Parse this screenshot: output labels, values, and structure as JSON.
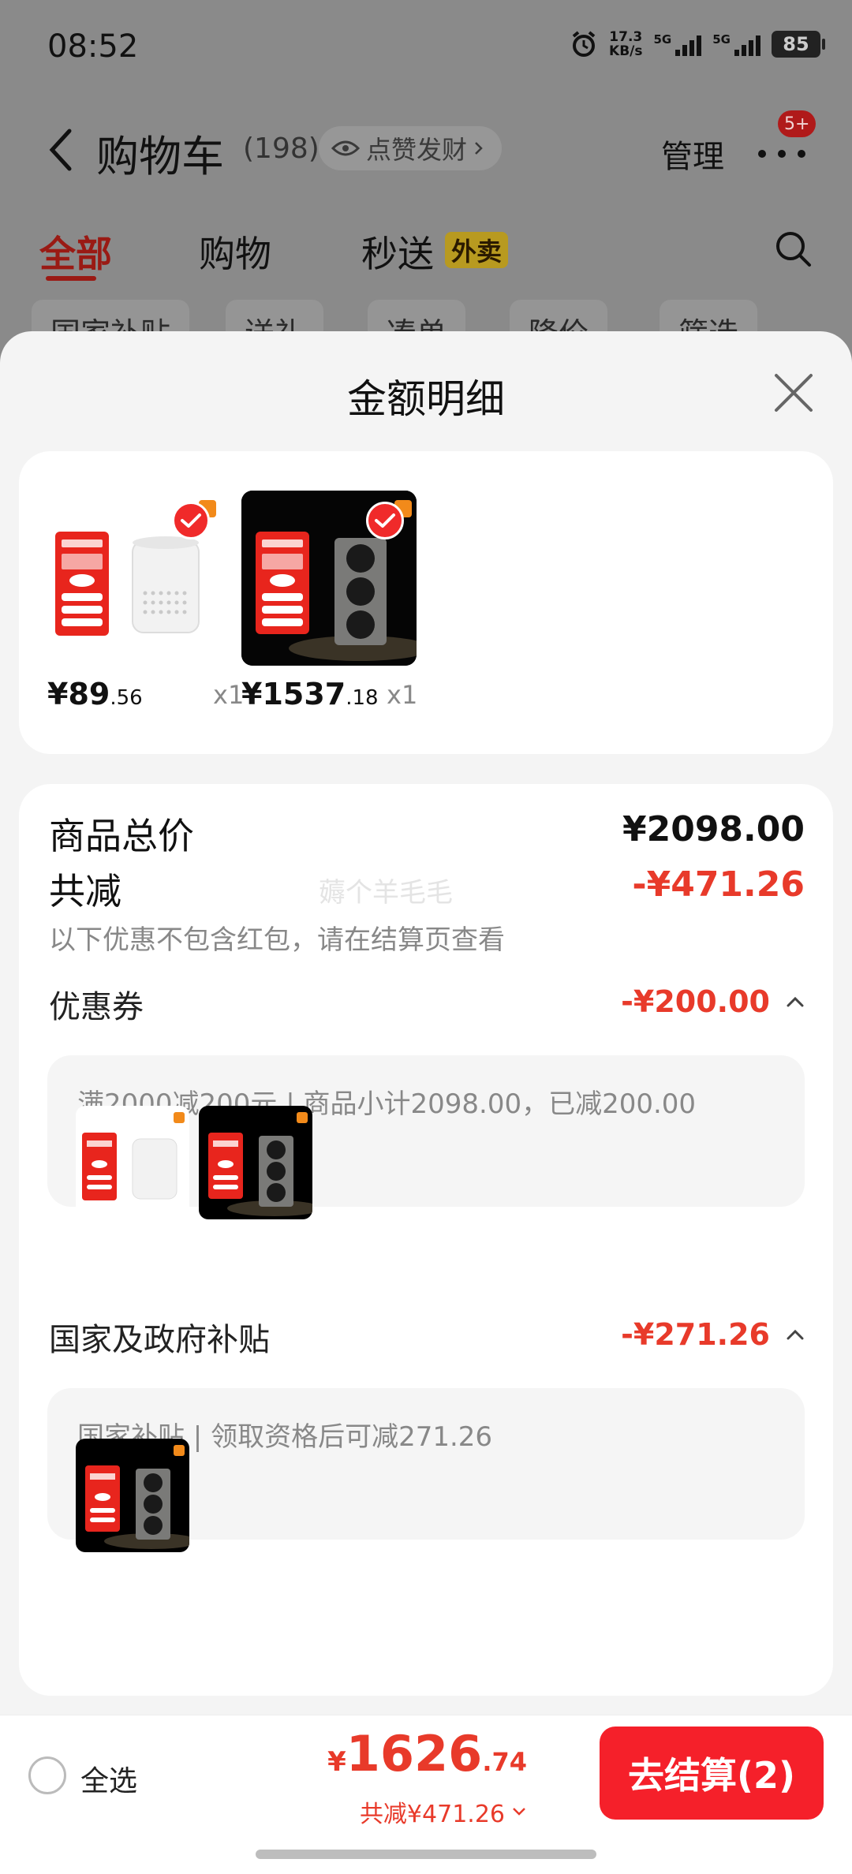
{
  "status_bar": {
    "time": "08:52",
    "net_speed_value": "17.3",
    "net_speed_unit": "KB/s",
    "sim1": "5G",
    "sim2": "5G",
    "battery": "85"
  },
  "nav": {
    "title": "购物车",
    "count": "(198)",
    "like_label": "点赞发财",
    "manage_label": "管理",
    "notify_badge": "5+"
  },
  "tabs": [
    {
      "label": "全部"
    },
    {
      "label": "购物"
    },
    {
      "label": "秒送"
    }
  ],
  "takeout_badge": "外卖",
  "filters": [
    "国家补贴",
    "送礼",
    "凑单",
    "降价",
    "筛选"
  ],
  "sheet": {
    "title": "金额明细",
    "products": [
      {
        "price_int": "¥89",
        "price_dec": ".56",
        "qty": "x1",
        "image": "xiaomi-speaker-play-white"
      },
      {
        "price_int": "¥1537",
        "price_dec": ".18",
        "qty": "x1",
        "image": "xiaomi-sound-2-max-black"
      }
    ],
    "goods_total_label": "商品总价",
    "goods_total_value": "¥2098.00",
    "watermark": "薅个羊毛毛",
    "discount_label": "共减",
    "discount_value": "-¥471.26",
    "discount_note": "以下优惠不包含红包，请在结算页查看",
    "coupon": {
      "label": "优惠券",
      "value": "-¥200.00",
      "desc": "满2000减200元 | 商品小计2098.00，已减200.00"
    },
    "subsidy": {
      "label": "国家及政府补贴",
      "value": "-¥271.26",
      "desc": "国家补贴 | 领取资格后可减271.26"
    }
  },
  "bottom": {
    "select_all": "全选",
    "currency": "¥",
    "total_int": "1626",
    "total_dec": ".74",
    "total_discount": "共减¥471.26",
    "checkout": "去结算(2)"
  },
  "colors": {
    "accent_red": "#e83a2a",
    "checkout_red": "#f5202a"
  }
}
